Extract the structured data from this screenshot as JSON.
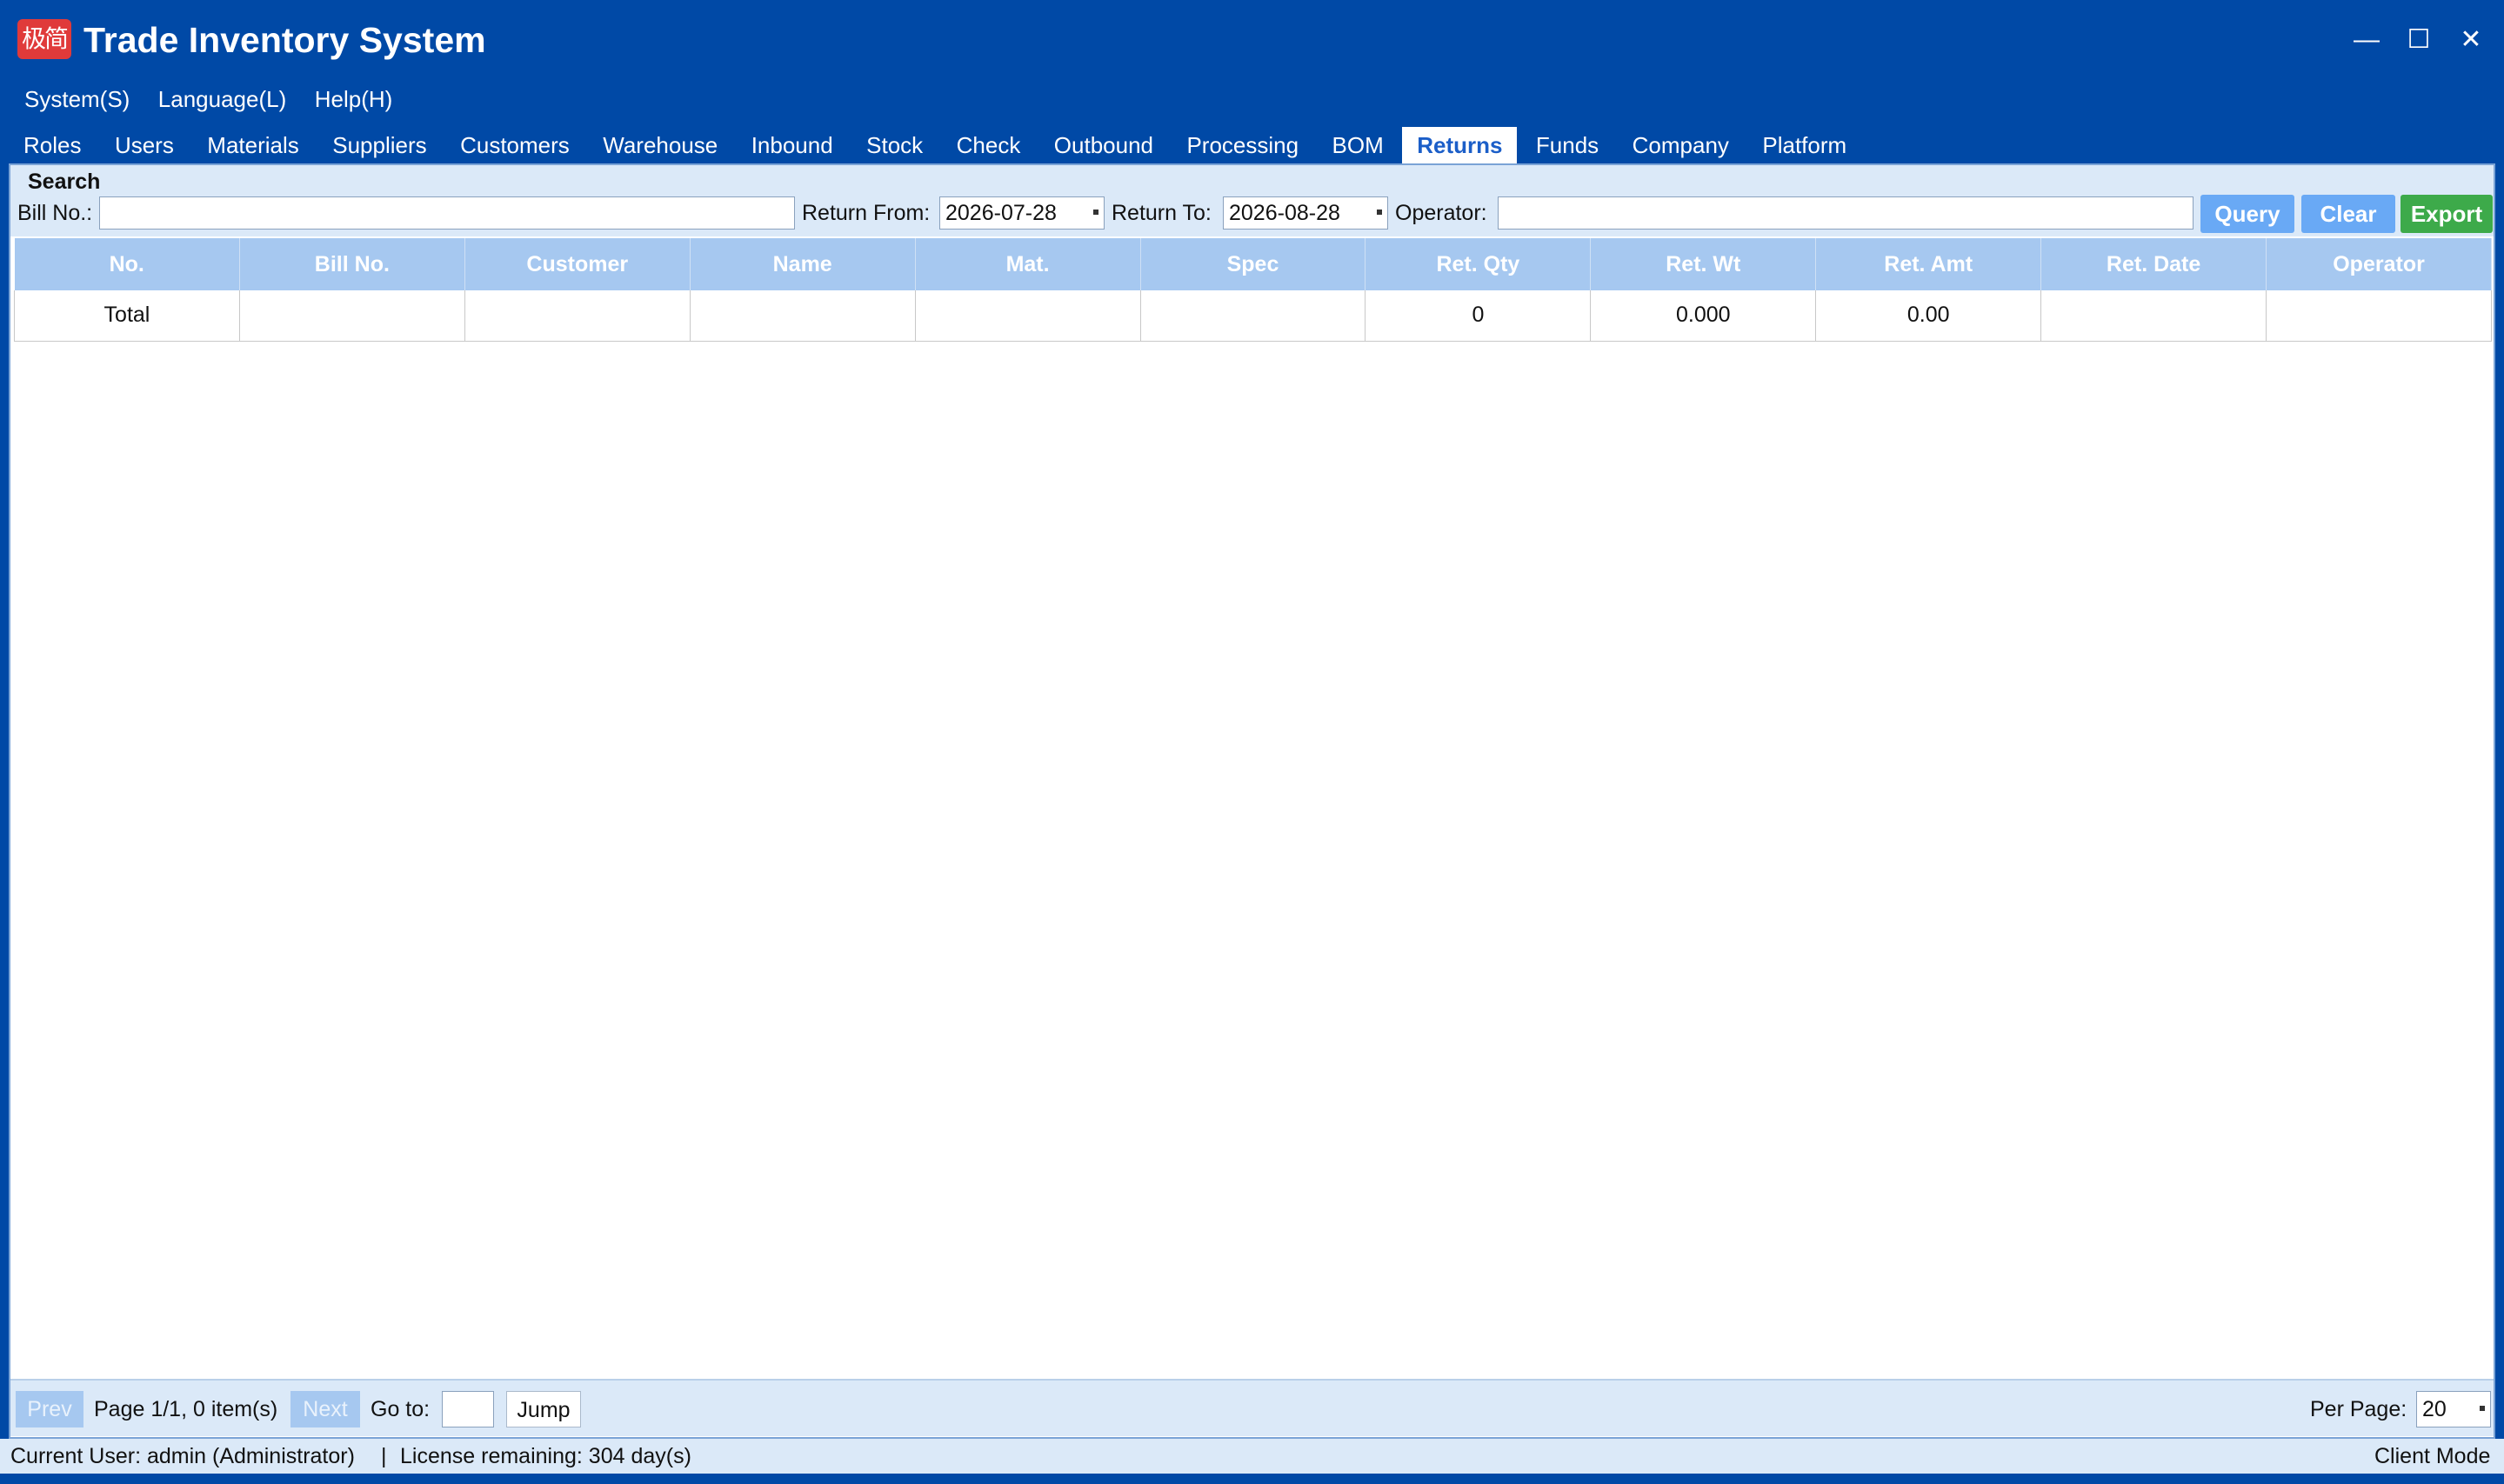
{
  "window": {
    "logo_text": "极简",
    "title": "Trade Inventory System",
    "controls": {
      "minimize": "—",
      "maximize": "☐",
      "close": "✕"
    }
  },
  "menu": [
    {
      "label": "System(S)"
    },
    {
      "label": "Language(L)"
    },
    {
      "label": "Help(H)"
    }
  ],
  "tabs": [
    {
      "label": "Roles"
    },
    {
      "label": "Users"
    },
    {
      "label": "Materials"
    },
    {
      "label": "Suppliers"
    },
    {
      "label": "Customers"
    },
    {
      "label": "Warehouse"
    },
    {
      "label": "Inbound"
    },
    {
      "label": "Stock"
    },
    {
      "label": "Check"
    },
    {
      "label": "Outbound"
    },
    {
      "label": "Processing"
    },
    {
      "label": "BOM"
    },
    {
      "label": "Returns",
      "active": true
    },
    {
      "label": "Funds"
    },
    {
      "label": "Company"
    },
    {
      "label": "Platform"
    }
  ],
  "search": {
    "legend": "Search",
    "bill_no_label": "Bill No.:",
    "bill_no_value": "",
    "return_from_label": "Return From:",
    "return_from_value": "2026-07-28",
    "return_to_label": "Return To:",
    "return_to_value": "2026-08-28",
    "operator_label": "Operator:",
    "operator_value": "",
    "query_label": "Query",
    "clear_label": "Clear",
    "export_label": "Export"
  },
  "table": {
    "columns": [
      "No.",
      "Bill No.",
      "Customer",
      "Name",
      "Mat.",
      "Spec",
      "Ret. Qty",
      "Ret. Wt",
      "Ret. Amt",
      "Ret. Date",
      "Operator"
    ],
    "total_row": [
      "Total",
      "",
      "",
      "",
      "",
      "",
      "0",
      "0.000",
      "0.00",
      "",
      ""
    ]
  },
  "pager": {
    "prev_label": "Prev",
    "page_info": "Page 1/1, 0 item(s)",
    "next_label": "Next",
    "goto_label": "Go to:",
    "goto_value": "",
    "jump_label": "Jump",
    "per_page_label": "Per Page:",
    "per_page_value": "20"
  },
  "status": {
    "user": "Current User: admin (Administrator)",
    "separator": "|",
    "license": "License remaining: 304 day(s)",
    "mode": "Client Mode"
  }
}
